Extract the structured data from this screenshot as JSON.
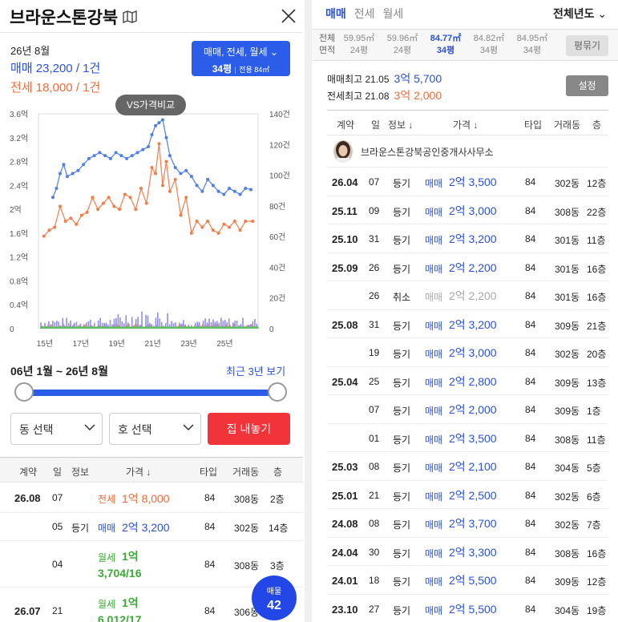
{
  "left": {
    "title": "브라운스톤강북",
    "date": "26년 8월",
    "sale_line": "매매 23,200 / 1건",
    "jeonse_line": "전세 18,000 / 1건",
    "type_button_line1": "매매, 전세, 월세",
    "type_button_pyeong": "34평",
    "type_button_area": "전용 84㎡",
    "vs_button": "VS가격비교",
    "range_text": "06년 1월 ~ 26년 8월",
    "recent_link": "최근 3년 보기",
    "dong_select": "동 선택",
    "ho_select": "호 선택",
    "sell_button": "집 내놓기",
    "table_headers": [
      "계약",
      "일",
      "정보",
      "가격 ↓",
      "타입",
      "거래동",
      "층"
    ],
    "rows": [
      {
        "ym": "26.08",
        "d": "07",
        "info": "",
        "kind": "전세",
        "price_a": "1억",
        "price_b": "8,000",
        "type": "84",
        "dong": "308동",
        "floor": "2층"
      },
      {
        "ym": "",
        "d": "05",
        "info": "등기",
        "kind": "매매",
        "price_a": "2억",
        "price_b": "3,200",
        "type": "84",
        "dong": "302동",
        "floor": "14층"
      },
      {
        "ym": "",
        "d": "04",
        "info": "",
        "kind": "월세",
        "price_a": "1억",
        "price_b": "3,704/16",
        "type": "84",
        "dong": "308동",
        "floor": "3층"
      },
      {
        "ym": "26.07",
        "d": "21",
        "info": "",
        "kind": "월세",
        "price_a": "1억",
        "price_b": "6,012/17",
        "type": "84",
        "dong": "306동",
        "floor": ""
      }
    ],
    "badge_label": "매물",
    "badge_count": "42"
  },
  "right": {
    "tabs": [
      "매매",
      "전세",
      "월세"
    ],
    "year_select": "전체년도",
    "area_label": "전체 면적",
    "areas": [
      {
        "m2": "59.95㎡",
        "py": "24평"
      },
      {
        "m2": "59.96㎡",
        "py": "24평"
      },
      {
        "m2": "84.77㎡",
        "py": "34평"
      },
      {
        "m2": "84.82㎡",
        "py": "34평"
      },
      {
        "m2": "84.95㎡",
        "py": "34평"
      }
    ],
    "pyeong_button": "평묶기",
    "max_sale_label": "매매최고 21.05",
    "max_sale_price": "3억 5,700",
    "max_jeonse_label": "전세최고 21.08",
    "max_jeonse_price": "3억 2,000",
    "settings_button": "설정",
    "table_headers": [
      "계약",
      "일",
      "정보 ↓",
      "가격 ↓",
      "타입",
      "거래동",
      "층"
    ],
    "agent": "브라운스톤강북공인중개사사무소",
    "rows": [
      {
        "ym": "26.04",
        "d": "07",
        "info": "등기",
        "kind": "매매",
        "price": "2억 3,500",
        "type": "84",
        "dong": "302동",
        "floor": "12층"
      },
      {
        "ym": "25.11",
        "d": "09",
        "info": "등기",
        "kind": "매매",
        "price": "2억 3,000",
        "type": "84",
        "dong": "308동",
        "floor": "22층"
      },
      {
        "ym": "25.10",
        "d": "31",
        "info": "등기",
        "kind": "매매",
        "price": "2억 3,200",
        "type": "84",
        "dong": "301동",
        "floor": "11층"
      },
      {
        "ym": "25.09",
        "d": "26",
        "info": "등기",
        "kind": "매매",
        "price": "2억 2,200",
        "type": "84",
        "dong": "301동",
        "floor": "16층"
      },
      {
        "ym": "",
        "d": "26",
        "info": "취소",
        "kind": "매매",
        "price": "2억 2,200",
        "type": "84",
        "dong": "301동",
        "floor": "16층",
        "cancel": true
      },
      {
        "ym": "25.08",
        "d": "31",
        "info": "등기",
        "kind": "매매",
        "price": "2억 3,200",
        "type": "84",
        "dong": "309동",
        "floor": "21층"
      },
      {
        "ym": "",
        "d": "19",
        "info": "등기",
        "kind": "매매",
        "price": "2억 3,000",
        "type": "84",
        "dong": "302동",
        "floor": "20층"
      },
      {
        "ym": "25.04",
        "d": "25",
        "info": "등기",
        "kind": "매매",
        "price": "2억 2,800",
        "type": "84",
        "dong": "309동",
        "floor": "13층"
      },
      {
        "ym": "",
        "d": "07",
        "info": "등기",
        "kind": "매매",
        "price": "2억 2,000",
        "type": "84",
        "dong": "309동",
        "floor": "1층"
      },
      {
        "ym": "",
        "d": "01",
        "info": "등기",
        "kind": "매매",
        "price": "2억 3,500",
        "type": "84",
        "dong": "308동",
        "floor": "11층"
      },
      {
        "ym": "25.03",
        "d": "08",
        "info": "등기",
        "kind": "매매",
        "price": "2억 2,100",
        "type": "84",
        "dong": "304동",
        "floor": "5층"
      },
      {
        "ym": "25.01",
        "d": "21",
        "info": "등기",
        "kind": "매매",
        "price": "2억 2,500",
        "type": "84",
        "dong": "302동",
        "floor": "6층"
      },
      {
        "ym": "24.08",
        "d": "08",
        "info": "등기",
        "kind": "매매",
        "price": "2억 3,700",
        "type": "84",
        "dong": "302동",
        "floor": "7층"
      },
      {
        "ym": "24.04",
        "d": "30",
        "info": "등기",
        "kind": "매매",
        "price": "2억 3,300",
        "type": "84",
        "dong": "308동",
        "floor": "16층"
      },
      {
        "ym": "24.01",
        "d": "18",
        "info": "등기",
        "kind": "매매",
        "price": "2억 5,500",
        "type": "84",
        "dong": "309동",
        "floor": "12층"
      },
      {
        "ym": "23.10",
        "d": "27",
        "info": "등기",
        "kind": "매매",
        "price": "2억 5,500",
        "type": "84",
        "dong": "304동",
        "floor": "19층"
      }
    ]
  },
  "colors": {
    "accent": "#2a52d9",
    "jeonse": "#f26b36",
    "wolse": "#3aaa35",
    "sell": "#f1343a"
  },
  "chart_data": {
    "type": "line",
    "x_tick_labels": [
      "15년",
      "17년",
      "19년",
      "21년",
      "23년",
      "25년"
    ],
    "y_left_tick_labels": [
      "3.6억",
      "3.2억",
      "2.8억",
      "2.4억",
      "2억",
      "1.6억",
      "1.2억",
      "0.8억",
      "0.4억",
      "0"
    ],
    "y_right_tick_labels": [
      "140건",
      "120건",
      "100건",
      "80건",
      "60건",
      "40건",
      "20건",
      "0"
    ],
    "ylim_price": [
      0,
      3.6
    ],
    "ylim_count": [
      0,
      140
    ],
    "series": [
      {
        "name": "매매",
        "color": "#4f7ee8",
        "x": [
          2015.5,
          2015.7,
          2015.9,
          2016.1,
          2016.3,
          2016.6,
          2016.9,
          2017.2,
          2017.5,
          2017.8,
          2018.1,
          2018.4,
          2018.7,
          2019.0,
          2019.3,
          2019.6,
          2019.9,
          2020.2,
          2020.5,
          2020.8,
          2021.0,
          2021.2,
          2021.4,
          2021.6,
          2021.8,
          2022.0,
          2022.3,
          2022.6,
          2022.9,
          2023.2,
          2023.5,
          2023.8,
          2024.1,
          2024.4,
          2024.7,
          2025.0,
          2025.3,
          2025.6,
          2025.9,
          2026.2,
          2026.5
        ],
        "y": [
          2.2,
          2.35,
          2.6,
          2.75,
          2.55,
          2.6,
          2.65,
          2.75,
          2.85,
          2.9,
          2.95,
          2.9,
          2.85,
          2.95,
          2.9,
          2.85,
          2.9,
          2.95,
          3.0,
          3.05,
          3.25,
          3.4,
          3.45,
          3.5,
          3.2,
          2.9,
          2.7,
          2.6,
          2.65,
          2.55,
          2.4,
          2.3,
          2.5,
          2.4,
          2.3,
          2.25,
          2.35,
          2.3,
          2.25,
          2.35,
          2.33
        ]
      },
      {
        "name": "전세",
        "color": "#f27d4a",
        "x": [
          2015.0,
          2015.3,
          2015.6,
          2015.9,
          2016.2,
          2016.5,
          2016.8,
          2017.1,
          2017.4,
          2017.7,
          2018.0,
          2018.3,
          2018.6,
          2018.9,
          2019.2,
          2019.5,
          2019.8,
          2020.1,
          2020.4,
          2020.7,
          2021.0,
          2021.2,
          2021.4,
          2021.6,
          2021.8,
          2022.0,
          2022.3,
          2022.6,
          2022.9,
          2023.2,
          2023.5,
          2023.8,
          2024.1,
          2024.4,
          2024.7,
          2025.0,
          2025.3,
          2025.6,
          2025.9,
          2026.2,
          2026.6
        ],
        "y": [
          1.55,
          1.65,
          1.7,
          2.05,
          1.8,
          1.85,
          1.75,
          1.9,
          1.95,
          2.2,
          2.0,
          2.1,
          2.2,
          2.05,
          2.0,
          2.25,
          2.2,
          2.0,
          2.35,
          2.1,
          2.7,
          2.6,
          3.1,
          2.4,
          2.8,
          2.3,
          2.5,
          1.9,
          2.2,
          1.6,
          1.8,
          1.7,
          1.8,
          1.65,
          1.6,
          1.75,
          1.7,
          1.8,
          1.65,
          1.8,
          1.8
        ]
      }
    ]
  }
}
